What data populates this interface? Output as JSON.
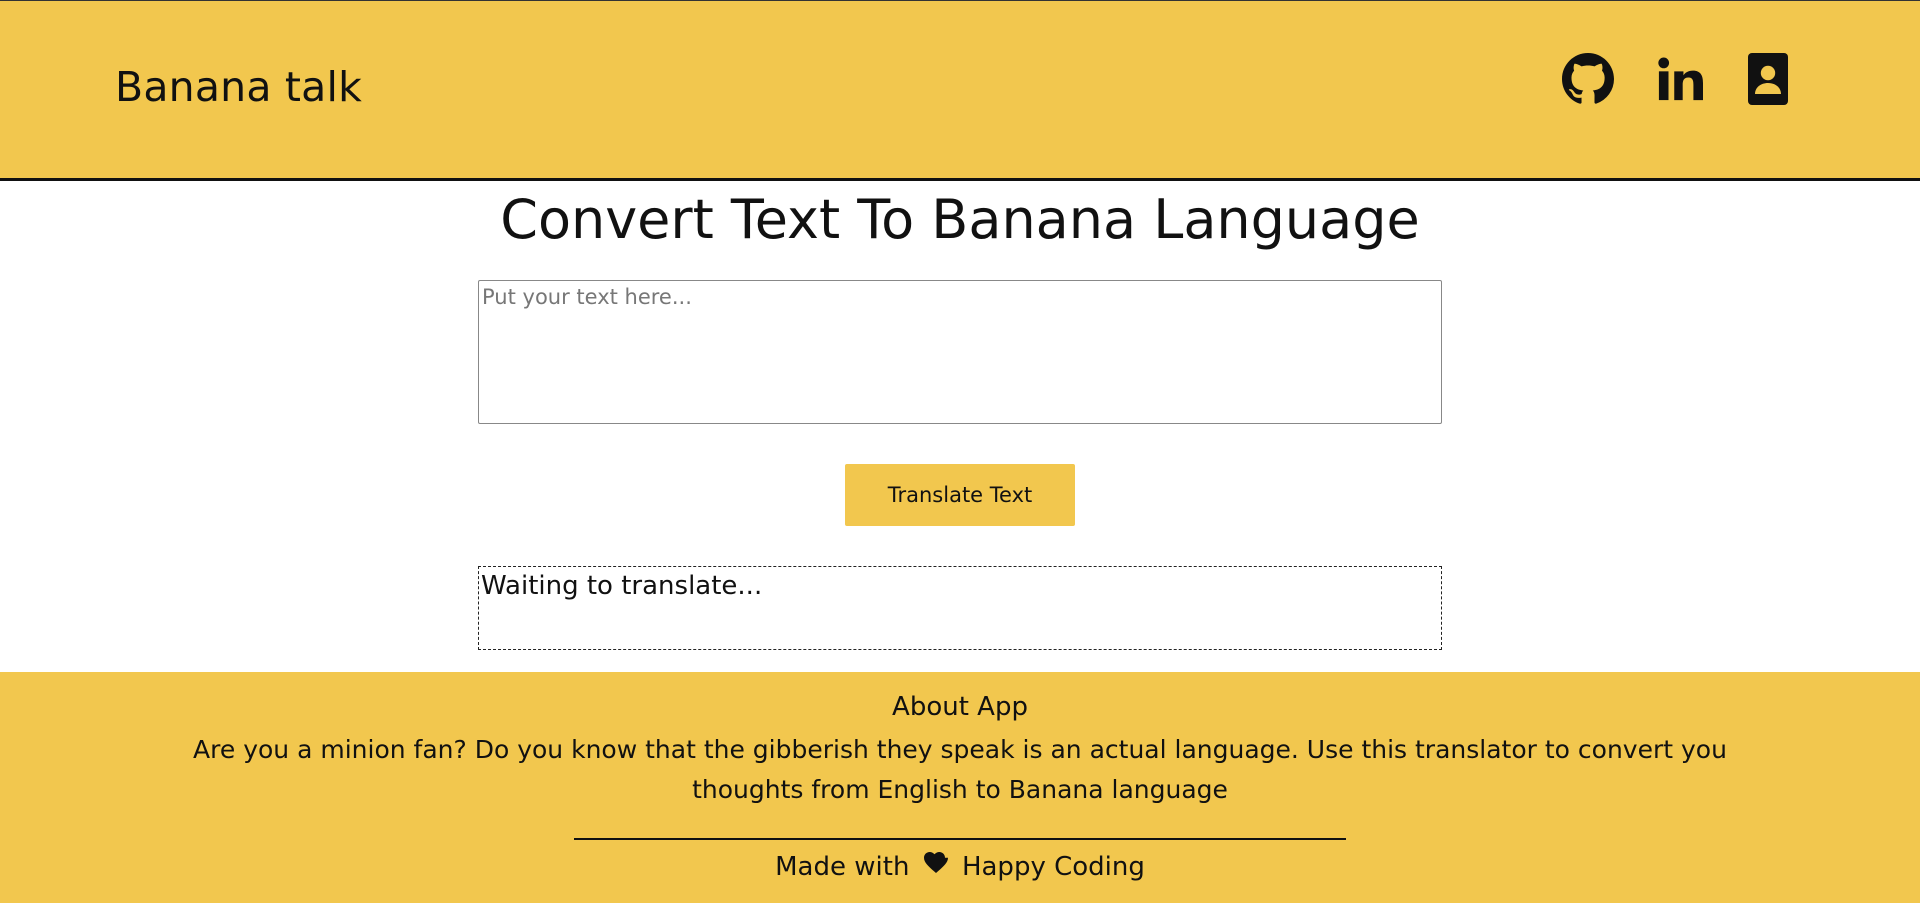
{
  "header": {
    "brand": "Banana talk",
    "icons": [
      "github-icon",
      "linkedin-icon",
      "contact-icon"
    ],
    "accent_color": "#F2C74E"
  },
  "main": {
    "title": "Convert Text To Banana Language",
    "input_placeholder": "Put your text here...",
    "input_value": "",
    "translate_button": "Translate Text",
    "output_text": "Waiting to translate..."
  },
  "footer": {
    "about_title": "About App",
    "about_text": "Are you a minion fan? Do you know that the gibberish they speak is an actual language. Use this translator to convert you thoughts from English to Banana language",
    "made_with_prefix": "Made with",
    "made_with_suffix": "Happy Coding",
    "heart_icon": "heart-icon"
  }
}
